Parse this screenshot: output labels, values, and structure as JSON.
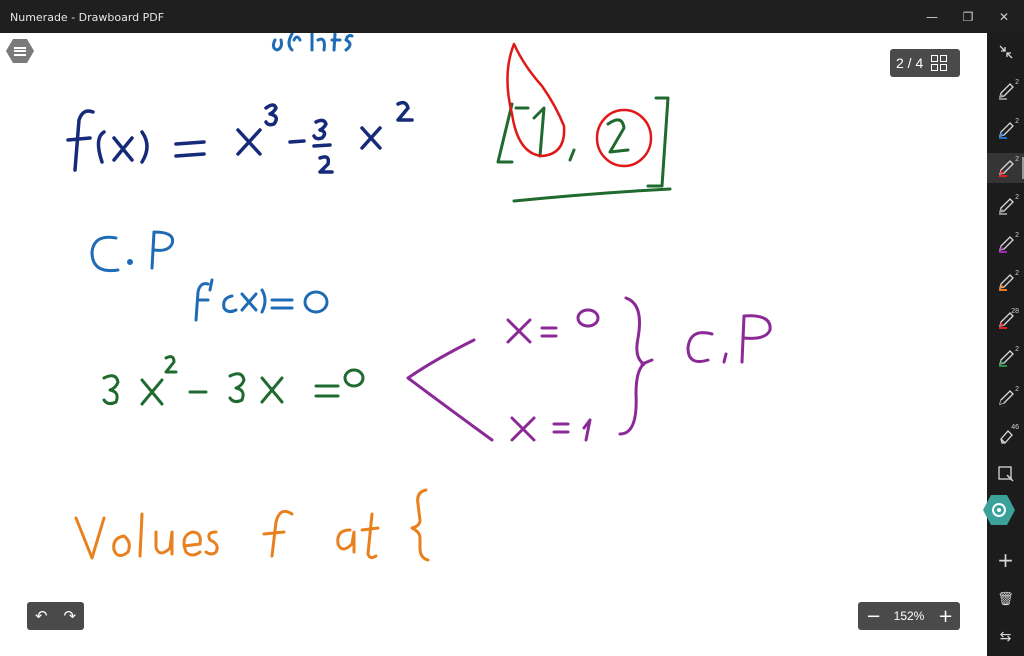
{
  "window": {
    "title": "Numerade - Drawboard PDF",
    "minimize_glyph": "—",
    "restore_glyph": "❐",
    "close_glyph": "✕"
  },
  "page_indicator": {
    "text": "2 / 4",
    "icon": "grid-view-icon"
  },
  "zoom": {
    "value": "152%",
    "minus": "−",
    "plus": "+"
  },
  "history": {
    "undo_glyph": "↶",
    "redo_glyph": "↷"
  },
  "toolbar": {
    "tools": [
      {
        "name": "collapse-arrows",
        "size": ""
      },
      {
        "name": "pen",
        "color": "#8a8a8a",
        "size": "2"
      },
      {
        "name": "pen",
        "color": "#1e6fc6",
        "size": "2"
      },
      {
        "name": "pen",
        "color": "#e02020",
        "size": "2",
        "active": true
      },
      {
        "name": "pen",
        "color": "#8a8a8a",
        "size": "2"
      },
      {
        "name": "pen",
        "color": "#a02ab0",
        "size": "2"
      },
      {
        "name": "pen",
        "color": "#f07a1a",
        "size": "2"
      },
      {
        "name": "highlighter",
        "color": "#e02020",
        "size": "28"
      },
      {
        "name": "pen",
        "color": "#2e8a44",
        "size": "2"
      },
      {
        "name": "pen",
        "color": "#222222",
        "size": "2"
      },
      {
        "name": "eraser",
        "color": "#cfcfcf",
        "size": "46"
      },
      {
        "name": "select",
        "size": ""
      }
    ],
    "bottom": {
      "add_glyph": "+",
      "trash_glyph": "🗑",
      "swap_glyph": "⇆"
    }
  },
  "colors": {
    "navy": "#152a78",
    "blue": "#1e6cb5",
    "green": "#1f6a2e",
    "purple": "#8b2a96",
    "orange": "#e8801e",
    "red": "#e01818",
    "accent_lasso": "#3aa29a"
  }
}
